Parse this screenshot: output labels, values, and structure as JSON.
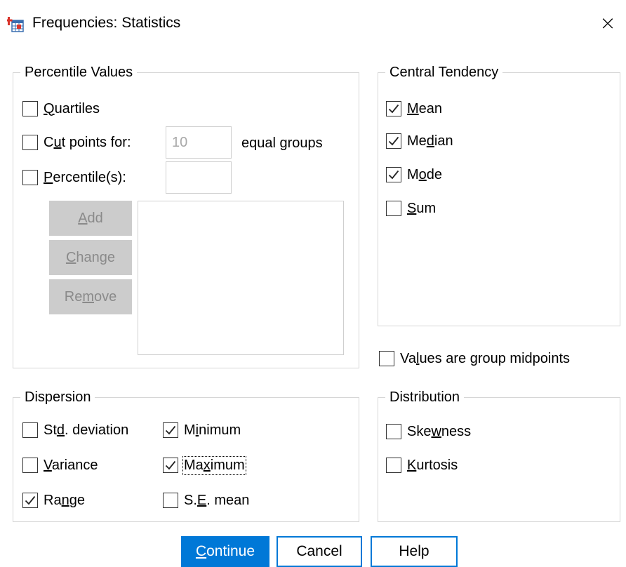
{
  "window": {
    "title": "Frequencies: Statistics",
    "close_glyph": "×"
  },
  "percentile_values": {
    "legend": "Percentile Values",
    "quartiles": {
      "label_pre": "",
      "label_u": "Q",
      "label_post": "uartiles",
      "checked": false
    },
    "cut_points": {
      "label_pre": "C",
      "label_u": "u",
      "label_post": "t points for:",
      "checked": false,
      "value": "10",
      "suffix": "equal groups"
    },
    "percentiles": {
      "label_pre": "",
      "label_u": "P",
      "label_post": "ercentile(s):",
      "checked": false,
      "value": ""
    },
    "buttons": {
      "add": {
        "pre": "",
        "u": "A",
        "post": "dd"
      },
      "change": {
        "pre": "",
        "u": "C",
        "post": "hange"
      },
      "remove": {
        "pre": "Re",
        "u": "m",
        "post": "ove"
      }
    }
  },
  "central_tendency": {
    "legend": "Central Tendency",
    "mean": {
      "label_pre": "",
      "label_u": "M",
      "label_post": "ean",
      "checked": true
    },
    "median": {
      "label_pre": "Me",
      "label_u": "d",
      "label_post": "ian",
      "checked": true
    },
    "mode": {
      "label_pre": "M",
      "label_u": "o",
      "label_post": "de",
      "checked": true
    },
    "sum": {
      "label_pre": "",
      "label_u": "S",
      "label_post": "um",
      "checked": false
    }
  },
  "group_midpoints": {
    "label_pre": "Va",
    "label_u": "l",
    "label_post": "ues are group midpoints",
    "checked": false
  },
  "dispersion": {
    "legend": "Dispersion",
    "std_deviation": {
      "label_pre": "St",
      "label_u": "d",
      "label_post": ". deviation",
      "checked": false
    },
    "minimum": {
      "label_pre": "M",
      "label_u": "i",
      "label_post": "nimum",
      "checked": true
    },
    "variance": {
      "label_pre": "",
      "label_u": "V",
      "label_post": "ariance",
      "checked": false
    },
    "maximum": {
      "label_pre": "Ma",
      "label_u": "x",
      "label_post": "imum",
      "checked": true
    },
    "range": {
      "label_pre": "Ra",
      "label_u": "n",
      "label_post": "ge",
      "checked": true
    },
    "se_mean": {
      "label_pre": "S.",
      "label_u": "E",
      "label_post": ". mean",
      "checked": false
    }
  },
  "distribution": {
    "legend": "Distribution",
    "skewness": {
      "label_pre": "Ske",
      "label_u": "w",
      "label_post": "ness",
      "checked": false
    },
    "kurtosis": {
      "label_pre": "",
      "label_u": "K",
      "label_post": "urtosis",
      "checked": false
    }
  },
  "footer": {
    "continue": {
      "pre": "",
      "u": "C",
      "post": "ontinue"
    },
    "cancel": "Cancel",
    "help": "Help"
  },
  "colors": {
    "accent": "#0078d7",
    "disabled_button_bg": "#cccccc",
    "group_border": "#d6d6d6"
  },
  "icons": {
    "app": "spss-table-icon",
    "close": "close-icon",
    "check": "check-icon"
  }
}
